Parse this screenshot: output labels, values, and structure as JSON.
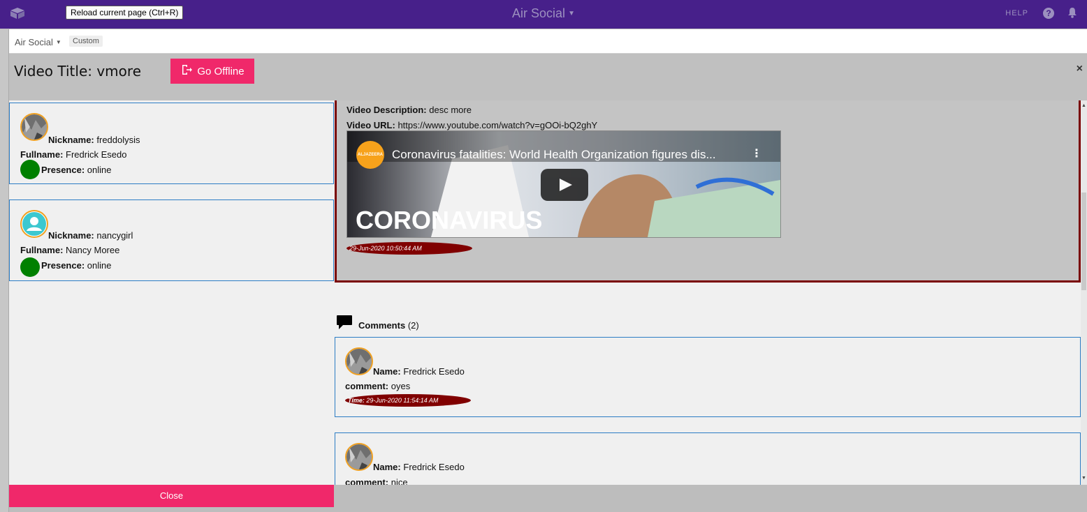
{
  "topbar": {
    "app_title": "Air Social",
    "help_label": "HELP",
    "tooltip": "Reload current page (Ctrl+R)",
    "logo_icon": "cube-logo-icon",
    "help_icon": "question-circle-icon",
    "bell_icon": "bell-icon"
  },
  "subbar": {
    "app_switch": "Air Social",
    "custom_badge": "Custom"
  },
  "modal": {
    "title": "Video Title: vmore",
    "offline_button": "Go Offline",
    "close_x": "×",
    "close_button": "Close"
  },
  "users": [
    {
      "nickname_label": "Nickname:",
      "nickname": "freddolysis",
      "fullname_label": "Fullname:",
      "fullname": "Fredrick Esedo",
      "presence_label": "Presence:",
      "presence": "online",
      "avatar": "photo"
    },
    {
      "nickname_label": "Nickname:",
      "nickname": "nancygirl",
      "fullname_label": "Fullname:",
      "fullname": "Nancy Moree",
      "presence_label": "Presence:",
      "presence": "online",
      "avatar": "default"
    }
  ],
  "video": {
    "description_label": "Video Description:",
    "description": "desc more",
    "url_label": "Video URL:",
    "url": "https://www.youtube.com/watch?v=gOOi-bQ2ghY",
    "embed_title": "Coronavirus fatalities: World Health Organization figures dis...",
    "channel": "ALJAZEERA",
    "banner_text": "CORONAVIRUS",
    "timestamp": "29-Jun-2020 10:50:44 AM"
  },
  "comments_header": {
    "label": "Comments",
    "count": "(2)"
  },
  "comments": [
    {
      "name_label": "Name:",
      "name": "Fredrick Esedo",
      "comment_label": "comment:",
      "comment": "oyes",
      "time_label": "Time:",
      "time": "29-Jun-2020 11:54:14 AM"
    },
    {
      "name_label": "Name:",
      "name": "Fredrick Esedo",
      "comment_label": "comment:",
      "comment": "nice"
    }
  ],
  "colors": {
    "topbar": "#47208a",
    "accent": "#f0286a",
    "presence_online": "#008000",
    "timestamp_pill": "#800000",
    "card_border": "#2b7cc4"
  }
}
